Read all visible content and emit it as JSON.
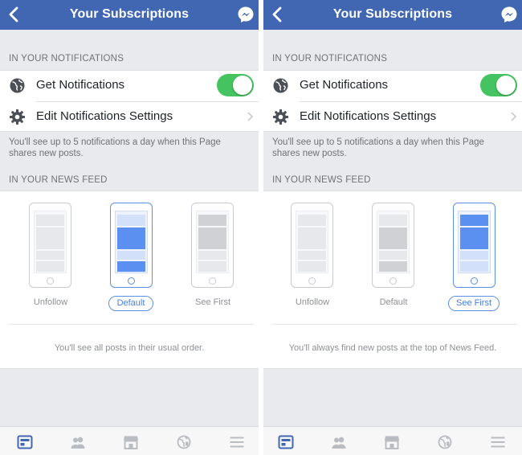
{
  "screens": [
    {
      "nav": {
        "title": "Your Subscriptions"
      },
      "notifications": {
        "section_label": "IN YOUR NOTIFICATIONS",
        "get_label": "Get Notifications",
        "get_enabled": true,
        "edit_label": "Edit Notifications Settings",
        "info": "You'll see up to 5 notifications a day when this Page shares new posts."
      },
      "news_feed": {
        "section_label": "IN YOUR NEWS FEED",
        "options": [
          "Unfollow",
          "Default",
          "See First"
        ],
        "selected": "Default",
        "description": "You'll see all posts in their usual order."
      }
    },
    {
      "nav": {
        "title": "Your Subscriptions"
      },
      "notifications": {
        "section_label": "IN YOUR NOTIFICATIONS",
        "get_label": "Get Notifications",
        "get_enabled": true,
        "edit_label": "Edit Notifications Settings",
        "info": "You'll see up to 5 notifications a day when this Page shares new posts."
      },
      "news_feed": {
        "section_label": "IN YOUR NEWS FEED",
        "options": [
          "Unfollow",
          "Default",
          "See First"
        ],
        "selected": "See First",
        "description": "You'll always find new posts at the top of News Feed."
      }
    }
  ],
  "tabbar_icons": [
    "news-feed-icon",
    "friends-icon",
    "marketplace-icon",
    "notifications-globe-icon",
    "menu-icon"
  ],
  "colors": {
    "nav_blue": "#4267b2",
    "toggle_green": "#44c360",
    "accent_blue": "#5c8fe6",
    "active_tab": "#4267b2"
  }
}
